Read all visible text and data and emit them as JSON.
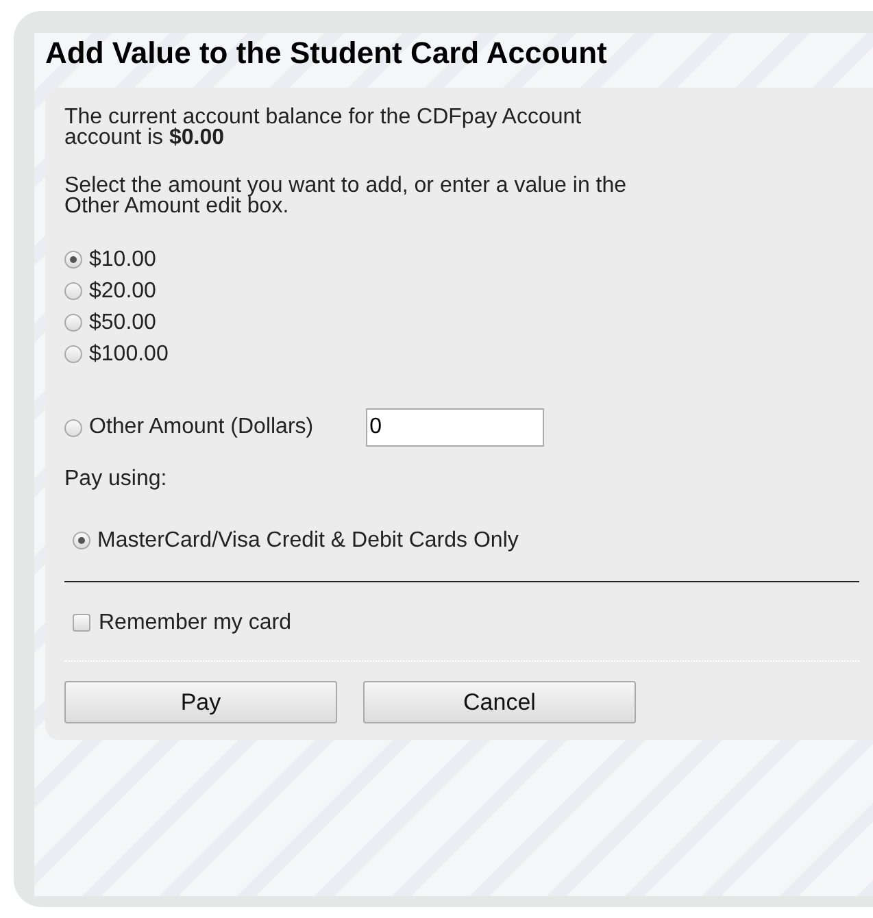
{
  "title": "Add Value to the Student Card Account",
  "balance_text": "The current account balance for the CDFpay Account account is **$0.00**",
  "instructions": "Select the amount you want to add, or enter a value in the Other Amount edit box.",
  "amounts": [
    {
      "label": "$10.00",
      "selected": true
    },
    {
      "label": "$20.00",
      "selected": false
    },
    {
      "label": "$50.00",
      "selected": false
    },
    {
      "label": "$100.00",
      "selected": false
    }
  ],
  "other_amount": {
    "label": "Other Amount (Dollars)",
    "selected": false,
    "value": "0"
  },
  "pay_using_label": "Pay using:",
  "payment_methods": [
    {
      "label": "MasterCard/Visa Credit & Debit Cards Only",
      "selected": true
    }
  ],
  "remember_card": {
    "label": "Remember my card",
    "checked": false
  },
  "buttons": [
    "Pay",
    "Cancel"
  ]
}
